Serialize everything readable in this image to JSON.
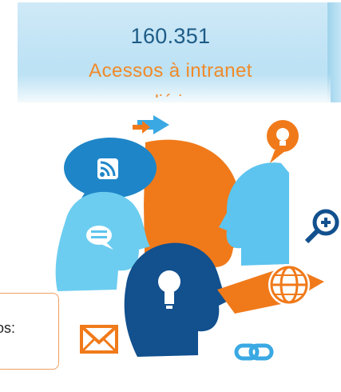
{
  "metric": {
    "value": "160.351",
    "label": "Acessos à intranet",
    "caption_clipped": "diário"
  },
  "callout": {
    "text": "os:"
  },
  "colors": {
    "value_text": "#1d5b86",
    "label_text": "#f08a2a",
    "banner": "#c3e5f6",
    "head_blue": "#1e86c8",
    "head_orange": "#f07a1a",
    "head_light_blue": "#5cc4ee",
    "head_navy": "#12508e"
  },
  "illustration_icons": [
    "rss-icon",
    "chat-icon",
    "lightbulb-icon",
    "zoom-in-icon",
    "globe-icon",
    "mail-icon",
    "link-icon",
    "arrow-icon"
  ]
}
